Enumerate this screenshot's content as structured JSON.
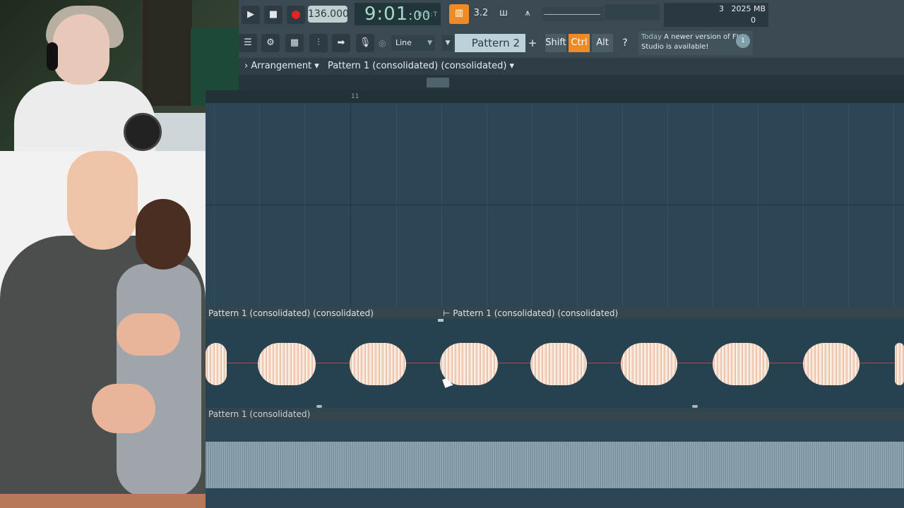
{
  "transport": {
    "tempo": "136.000",
    "time": "9:01",
    "time_ticks": ":00",
    "time_label": "B:S:T"
  },
  "memory": {
    "voices": "3",
    "mb": "2025 MB",
    "cpu": "0"
  },
  "toolbar": {
    "line_mode": "Line",
    "pattern": "Pattern 2",
    "shift": "Shift",
    "ctrl": "Ctrl",
    "alt": "Alt",
    "news_today": "Today",
    "news_text": "A newer version of FL Studio is available!",
    "news_badge": "1"
  },
  "playlist": {
    "view": "Arrangement",
    "title": "Pattern 1 (consolidated) (consolidated)",
    "ruler_mark": "11",
    "clip1": "Pattern 1 (consolidated) (consolidated)",
    "clip2": "Pattern 1 (consolidated) (consolidated)",
    "clip3": "Pattern 1 (consolidated)"
  },
  "colors": {
    "accent": "#f08a24",
    "background": "#2c4657",
    "waveform": "#f5d9c6"
  },
  "icons": [
    "play-icon",
    "stop-icon",
    "record-icon",
    "piano-icon",
    "metronome-icon",
    "loop-icon",
    "waveform-icon",
    "browser-icon",
    "channel-rack-icon",
    "piano-roll-icon",
    "mixer-icon",
    "arrow-icon",
    "mic-icon",
    "help-icon",
    "cursor-icon"
  ]
}
